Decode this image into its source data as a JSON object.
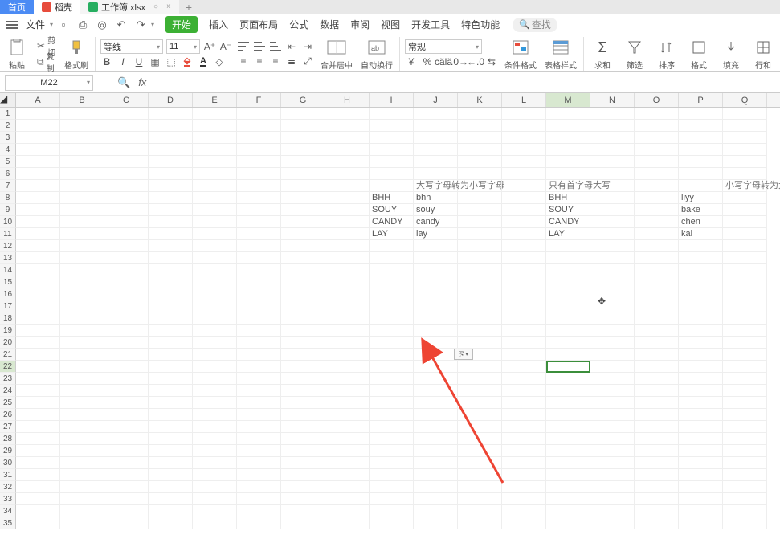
{
  "tabs": {
    "home": "首页",
    "doc": "稻壳",
    "sheet": "工作簿.xlsx"
  },
  "menubar": {
    "file": "文件",
    "search_placeholder": "查找"
  },
  "ribbon_tabs": [
    "开始",
    "插入",
    "页面布局",
    "公式",
    "数据",
    "审阅",
    "视图",
    "开发工具",
    "特色功能"
  ],
  "ribbon": {
    "paste": "粘贴",
    "cut": "剪切",
    "copy": "复制",
    "format_painter": "格式刷",
    "font_name": "等线",
    "font_size": "11",
    "merge_center": "合并居中",
    "wrap_text": "自动换行",
    "number_format": "常规",
    "cond_format": "条件格式",
    "table_style": "表格样式",
    "sum": "求和",
    "filter": "筛选",
    "sort": "排序",
    "format": "格式",
    "fill": "填充",
    "row_col": "行和"
  },
  "namebox": "M22",
  "columns": [
    "A",
    "B",
    "C",
    "D",
    "E",
    "F",
    "G",
    "H",
    "I",
    "J",
    "K",
    "L",
    "M",
    "N",
    "O",
    "P",
    "Q"
  ],
  "row_count": 35,
  "selected": {
    "col": "M",
    "row": 22
  },
  "cells": {
    "7": {
      "J": "大写字母转为小写字母",
      "M": "只有首字母大写",
      "Q": "小写字母转为大写字"
    },
    "8": {
      "I": "BHH",
      "J": "bhh",
      "M": "BHH",
      "P": "liyy"
    },
    "9": {
      "I": "SOUY",
      "J": "souy",
      "M": "SOUY",
      "P": "bake"
    },
    "10": {
      "I": "CANDY",
      "J": "candy",
      "M": "CANDY",
      "P": "chen"
    },
    "11": {
      "I": "LAY",
      "J": "lay",
      "M": "LAY",
      "P": "kai"
    }
  },
  "smart_tag": "⎘"
}
